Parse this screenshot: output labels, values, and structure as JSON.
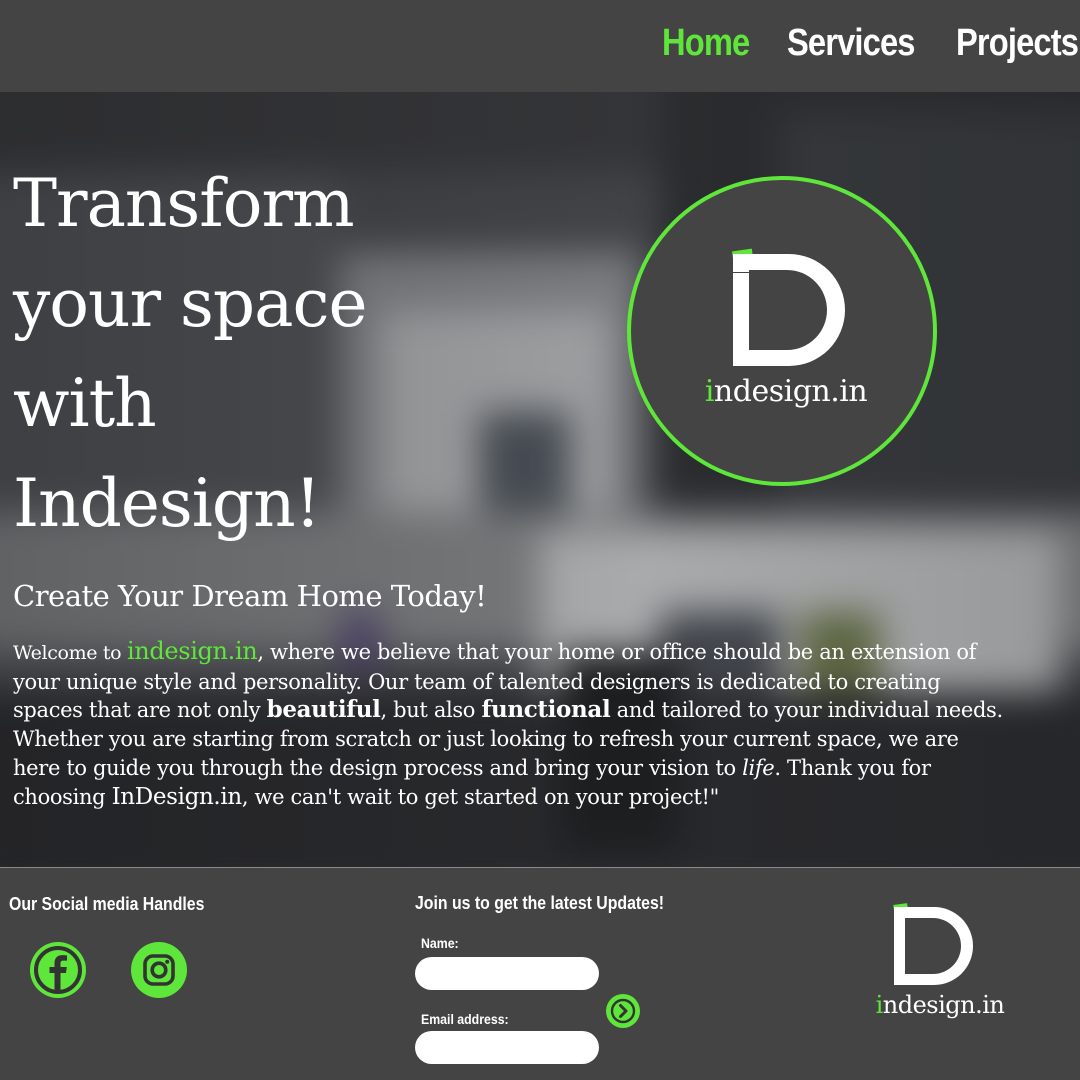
{
  "nav": {
    "items": [
      {
        "label": "Home",
        "active": true
      },
      {
        "label": "Services",
        "active": false
      },
      {
        "label": "Projects",
        "active": false
      }
    ]
  },
  "hero": {
    "title_lines": [
      "Transform",
      "your space",
      "with",
      "Indesign!"
    ],
    "subtitle": "Create Your Dream Home Today!",
    "paragraph": {
      "p1": "Welcome to ",
      "brand": "indesign.in",
      "p2": ", where we believe that your home or office should be an extension of your unique style and personality. Our team of talented designers is dedicated to creating spaces that are not only ",
      "bold1": "beautiful",
      "p3": ", but also ",
      "bold2": "functional",
      "p4": " and tailored to your individual needs. Whether you are starting from scratch or just looking to refresh your current space, we are here to guide you through the design process and bring your vision to ",
      "italic1": "life",
      "p5": ". Thank you for choosing ",
      "brand2": "InDesign.in",
      "p6": ", we can't wait to get started on your project!\""
    },
    "logo_text": "indesign.in"
  },
  "footer": {
    "social_heading": "Our Social media Handles",
    "social_icons": [
      "facebook-icon",
      "instagram-icon"
    ],
    "newsletter_heading": "Join us to get the latest Updates!",
    "name_label": "Name:",
    "name_value": "",
    "email_label": "Email address:",
    "email_value": "",
    "submit_icon": "chevron-right-icon",
    "logo_text": "indesign.in"
  },
  "colors": {
    "accent": "#5ee63a",
    "bar": "#444444",
    "text": "#ffffff"
  }
}
